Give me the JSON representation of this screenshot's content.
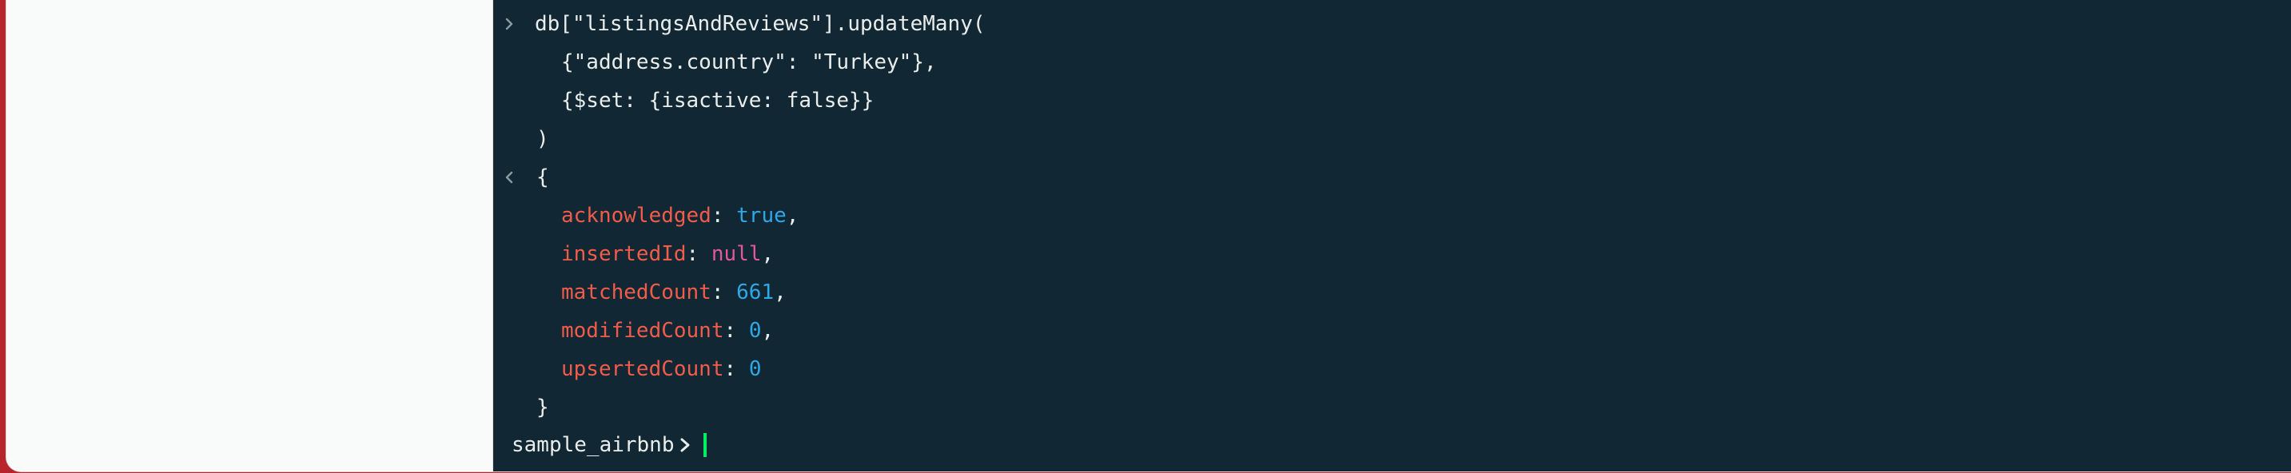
{
  "shell": {
    "input": {
      "line1": "db[\"listingsAndReviews\"].updateMany(",
      "line2": "{\"address.country\": \"Turkey\"},",
      "line3": "{$set: {isactive: false}}",
      "line4": ")"
    },
    "output": {
      "open_brace": "{",
      "close_brace": "}",
      "fields": [
        {
          "key": "acknowledged",
          "value": "true",
          "sep": ","
        },
        {
          "key": "insertedId",
          "value": "null",
          "sep": ","
        },
        {
          "key": "matchedCount",
          "value": "661",
          "sep": ","
        },
        {
          "key": "modifiedCount",
          "value": "0",
          "sep": ","
        },
        {
          "key": "upsertedCount",
          "value": "0",
          "sep": ""
        }
      ]
    },
    "prompt": {
      "database": "sample_airbnb"
    },
    "colors": {
      "background": "#112733",
      "key": "#f15b4a",
      "number_bool": "#2ea8e6",
      "null": "#e3589a",
      "cursor": "#00ed64"
    }
  }
}
